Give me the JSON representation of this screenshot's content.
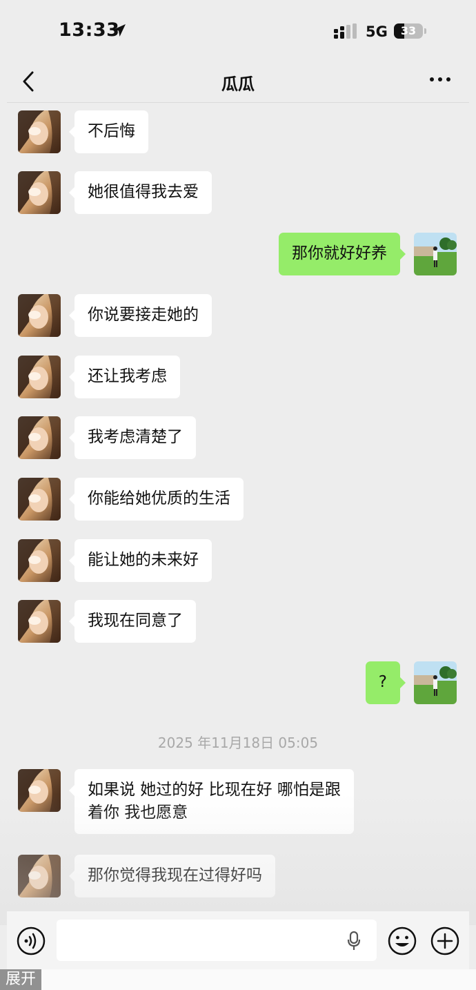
{
  "status": {
    "time": "13:33",
    "network": "5G",
    "battery": "33"
  },
  "header": {
    "title": "瓜瓜",
    "back_icon": "chevron-left-icon",
    "more_icon": "ellipsis-icon"
  },
  "messages": [
    {
      "side": "in",
      "text": "不后悔"
    },
    {
      "side": "in",
      "text": "她很值得我去爱"
    },
    {
      "side": "out",
      "text": "那你就好好养"
    },
    {
      "side": "in",
      "text": "你说要接走她的"
    },
    {
      "side": "in",
      "text": "还让我考虑"
    },
    {
      "side": "in",
      "text": "我考虑清楚了"
    },
    {
      "side": "in",
      "text": "你能给她优质的生活"
    },
    {
      "side": "in",
      "text": "能让她的未来好"
    },
    {
      "side": "in",
      "text": "我现在同意了"
    },
    {
      "side": "out",
      "text": "?"
    },
    {
      "side": "in",
      "text": "如果说 她过的好 比现在好 哪怕是跟\n着你 我也愿意"
    },
    {
      "side": "in",
      "text": "那你觉得我现在过得好吗"
    }
  ],
  "timestamp": "2025 年11月18日 05:05",
  "input_bar": {
    "voice_icon": "voice-icon",
    "mic_icon": "mic-icon",
    "emoji_icon": "emoji-icon",
    "plus_icon": "plus-icon"
  },
  "expand_label": "展开",
  "colors": {
    "background": "#ededed",
    "incoming_bubble": "#ffffff",
    "outgoing_bubble": "#95ec69"
  }
}
